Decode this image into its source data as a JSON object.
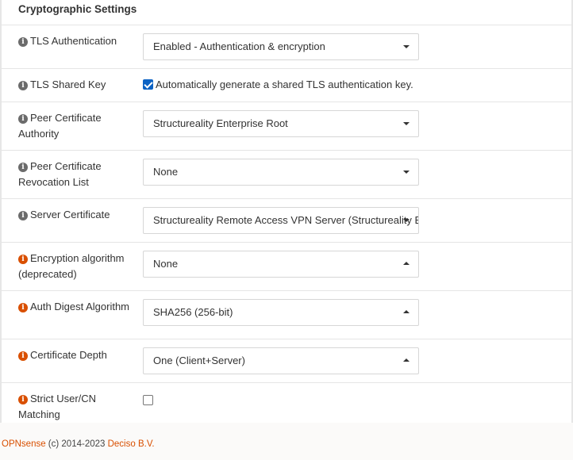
{
  "section": {
    "title": "Cryptographic Settings"
  },
  "rows": {
    "tls_auth": {
      "label": "TLS Authentication",
      "value": "Enabled - Authentication & encryption"
    },
    "tls_key": {
      "label": "TLS Shared Key",
      "checkbox_label": "Automatically generate a shared TLS authentication key.",
      "checked": true
    },
    "peer_ca": {
      "label": "Peer Certificate Authority",
      "value": "Structureality Enterprise Root"
    },
    "peer_crl": {
      "label": "Peer Certificate Revocation List",
      "value": "None"
    },
    "server_cert": {
      "label": "Server Certificate",
      "value": "Structureality Remote Access VPN Server (Structureality Enterprise Root)"
    },
    "encryption": {
      "label": "Encryption algorithm (deprecated)",
      "value": "None"
    },
    "auth_digest": {
      "label": "Auth Digest Algorithm",
      "value": "SHA256 (256-bit)"
    },
    "cert_depth": {
      "label": "Certificate Depth",
      "value": "One (Client+Server)"
    },
    "strict_cn": {
      "label": "Strict User/CN Matching",
      "checked": false
    }
  },
  "footer": {
    "brand": "OPNsense",
    "text": " (c) 2014-2023 ",
    "company": "Deciso B.V."
  },
  "icons": {
    "info_grey": "info-circle-grey",
    "info_orange": "info-circle-orange"
  },
  "colors": {
    "accent": "#d94f00",
    "checkbox": "#0b62c4"
  }
}
